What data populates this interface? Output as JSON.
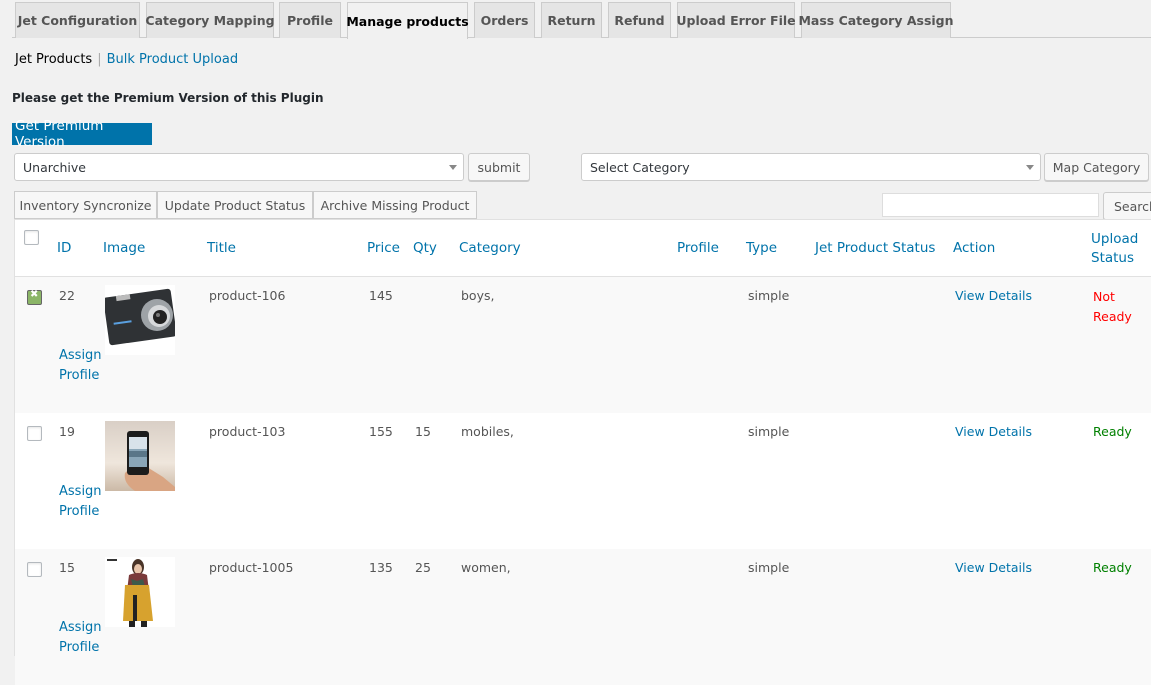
{
  "tabs": [
    {
      "label": "Jet Configuration",
      "active": false
    },
    {
      "label": "Category Mapping",
      "active": false
    },
    {
      "label": "Profile",
      "active": false
    },
    {
      "label": "Manage products",
      "active": true
    },
    {
      "label": "Orders",
      "active": false
    },
    {
      "label": "Return",
      "active": false
    },
    {
      "label": "Refund",
      "active": false
    },
    {
      "label": "Upload Error File",
      "active": false
    },
    {
      "label": "Mass Category Assign",
      "active": false
    }
  ],
  "subnav": {
    "current": "Jet Products",
    "separator": "|",
    "link": "Bulk Product Upload"
  },
  "premium": {
    "note": "Please get the Premium Version of this Plugin",
    "button": "Get Premium Version"
  },
  "actions": {
    "bulk_select_value": "Unarchive",
    "submit_label": "submit",
    "category_select_value": "Select Category",
    "map_category_label": "Map Category",
    "inventory_sync_label": "Inventory Syncronize",
    "update_status_label": "Update Product Status",
    "archive_missing_label": "Archive Missing Product",
    "search_value": "",
    "search_label": "Search"
  },
  "table": {
    "columns": {
      "id": "ID",
      "image": "Image",
      "title": "Title",
      "price": "Price",
      "qty": "Qty",
      "category": "Category",
      "profile": "Profile",
      "type": "Type",
      "jet_status": "Jet Product Status",
      "action": "Action",
      "upload_status_1": "Upload",
      "upload_status_2": "Status"
    },
    "assign_profile_1": "Assign",
    "assign_profile_2": "Profile",
    "rows": [
      {
        "checked": true,
        "id": "22",
        "image": "camera",
        "title": "product-106",
        "price": "145",
        "qty": "",
        "category": "boys,",
        "profile": "",
        "type": "simple",
        "jet_status": "",
        "action": "View Details",
        "upload_status_1": "Not",
        "upload_status_2": "Ready",
        "status_color": "#ff0000"
      },
      {
        "checked": false,
        "id": "19",
        "image": "phone-in-hand",
        "title": "product-103",
        "price": "155",
        "qty": "15",
        "category": "mobiles,",
        "profile": "",
        "type": "simple",
        "jet_status": "",
        "action": "View Details",
        "upload_status_1": "Ready",
        "upload_status_2": "",
        "status_color": "#008000"
      },
      {
        "checked": false,
        "id": "15",
        "image": "woman-in-coat",
        "title": "product-1005",
        "price": "135",
        "qty": "25",
        "category": "women,",
        "profile": "",
        "type": "simple",
        "jet_status": "",
        "action": "View Details",
        "upload_status_1": "Ready",
        "upload_status_2": "",
        "status_color": "#008000"
      }
    ]
  },
  "colors": {
    "accent": "#0073aa",
    "not_ready": "#ff0000",
    "ready": "#008000"
  }
}
